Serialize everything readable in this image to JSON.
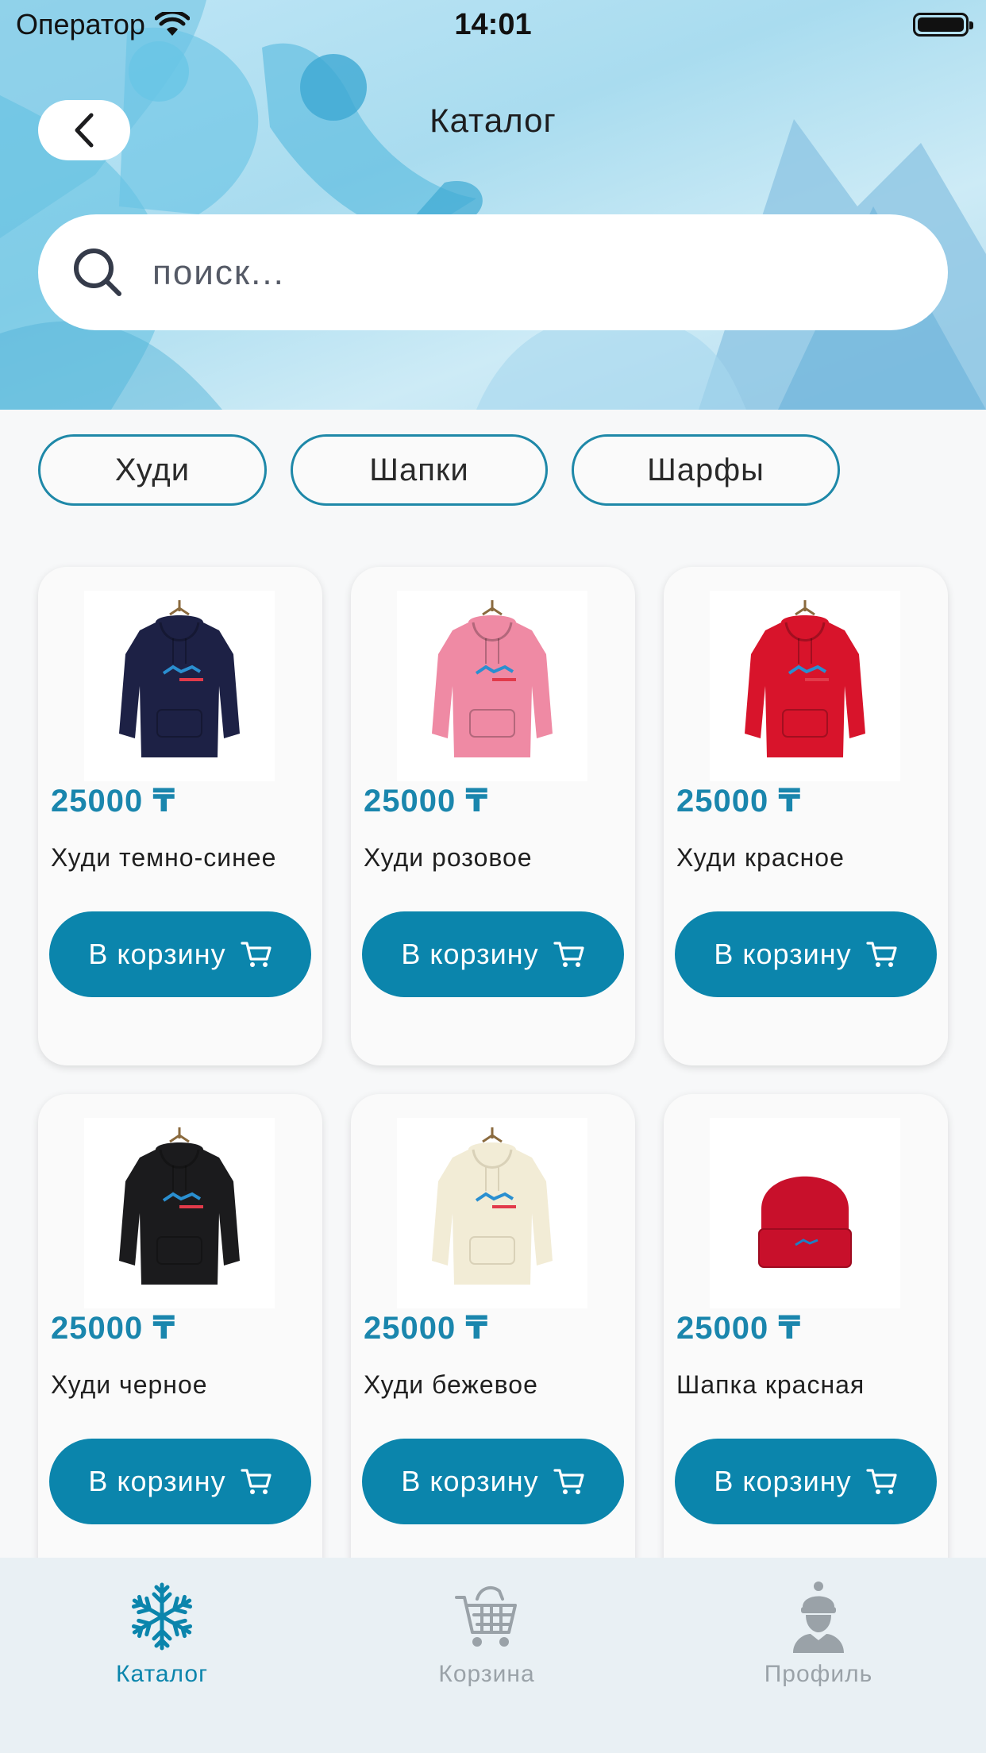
{
  "status_bar": {
    "carrier": "Оператор",
    "time": "14:01"
  },
  "header": {
    "title": "Каталог"
  },
  "search": {
    "placeholder": "поиск..."
  },
  "categories": [
    "Худи",
    "Шапки",
    "Шарфы"
  ],
  "products": [
    {
      "price": "25000 ₸",
      "name": "Худи темно-синее",
      "button": "В корзину",
      "color": "#1d2145"
    },
    {
      "price": "25000 ₸",
      "name": "Худи розовое",
      "button": "В корзину",
      "color": "#ef8aa4"
    },
    {
      "price": "25000 ₸",
      "name": "Худи красное",
      "button": "В корзину",
      "color": "#d8142b"
    },
    {
      "price": "25000 ₸",
      "name": "Худи черное",
      "button": "В корзину",
      "color": "#1b1b1d"
    },
    {
      "price": "25000 ₸",
      "name": "Худи бежевое",
      "button": "В корзину",
      "color": "#f2ecd6"
    },
    {
      "price": "25000 ₸",
      "name": "Шапка красная",
      "button": "В корзину",
      "color": "#c8102b"
    }
  ],
  "tabbar": {
    "items": [
      {
        "label": "Каталог",
        "icon": "snowflake-icon",
        "active": true
      },
      {
        "label": "Корзина",
        "icon": "cart-icon",
        "active": false
      },
      {
        "label": "Профиль",
        "icon": "person-icon",
        "active": false
      }
    ]
  },
  "colors": {
    "accent": "#0b85ac",
    "price": "#1a86ad",
    "inactive_tab": "#9aa2a8"
  }
}
